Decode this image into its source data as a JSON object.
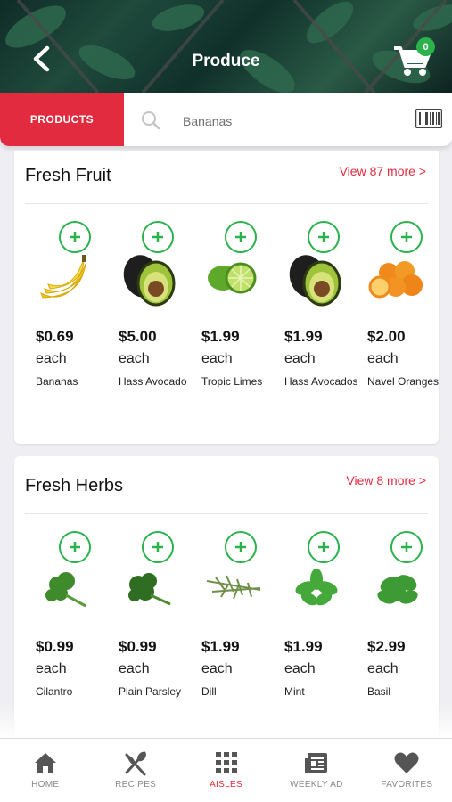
{
  "header": {
    "title": "Produce",
    "cart_count": "0"
  },
  "search": {
    "tab_label": "PRODUCTS",
    "query": "Bananas"
  },
  "sections": [
    {
      "title": "Fresh Fruit",
      "view_more": "View 87 more >",
      "products": [
        {
          "price": "$0.69",
          "unit": "each",
          "name": "Bananas",
          "icon": "banana-image"
        },
        {
          "price": "$5.00",
          "unit": "each",
          "name": "Hass Avocado",
          "icon": "avocado-image"
        },
        {
          "price": "$1.99",
          "unit": "each",
          "name": "Tropic Limes",
          "icon": "lime-image"
        },
        {
          "price": "$1.99",
          "unit": "each",
          "name": "Hass Avocados",
          "icon": "avocado-image"
        },
        {
          "price": "$2.00",
          "unit": "each",
          "name": "Navel Oranges",
          "icon": "orange-image"
        }
      ]
    },
    {
      "title": "Fresh Herbs",
      "view_more": "View 8 more >",
      "products": [
        {
          "price": "$0.99",
          "unit": "each",
          "name": "Cilantro",
          "icon": "cilantro-image"
        },
        {
          "price": "$0.99",
          "unit": "each",
          "name": "Plain Parsley",
          "icon": "parsley-image"
        },
        {
          "price": "$1.99",
          "unit": "each",
          "name": "Dill",
          "icon": "dill-image"
        },
        {
          "price": "$1.99",
          "unit": "each",
          "name": "Mint",
          "icon": "mint-image"
        },
        {
          "price": "$2.99",
          "unit": "each",
          "name": "Basil",
          "icon": "basil-image"
        }
      ]
    }
  ],
  "tabbar": [
    {
      "label": "HOME",
      "icon": "home-icon",
      "active": false
    },
    {
      "label": "RECIPES",
      "icon": "utensils-icon",
      "active": false
    },
    {
      "label": "AISLES",
      "icon": "grid-icon",
      "active": true
    },
    {
      "label": "WEEKLY AD",
      "icon": "newspaper-icon",
      "active": false
    },
    {
      "label": "FAVORITES",
      "icon": "heart-icon",
      "active": false
    }
  ],
  "colors": {
    "accent": "#e32b40",
    "add_green": "#2bb24c",
    "inactive": "#888888"
  }
}
